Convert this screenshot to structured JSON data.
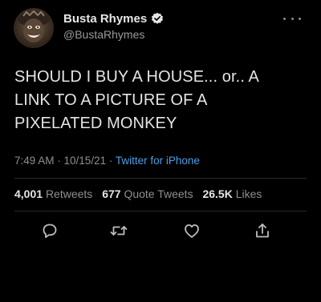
{
  "user": {
    "display_name": "Busta Rhymes",
    "handle": "@BustaRhymes",
    "verified": true
  },
  "tweet": {
    "text_lines": [
      "SHOULD I BUY A HOUSE... or.. A",
      "LINK TO A PICTURE OF A",
      "PIXELATED MONKEY"
    ],
    "time": "7:49 AM",
    "date": "10/15/21",
    "separator": " · ",
    "source": "Twitter for iPhone"
  },
  "stats": {
    "retweets_count": "4,001",
    "retweets_label": "Retweets",
    "quote_count": "677",
    "quote_label": "Quote Tweets",
    "likes_count": "26.5K",
    "likes_label": "Likes"
  },
  "colors": {
    "background": "#000000",
    "link_blue": "#4a9ee8",
    "verified_blue": "#1d9bf0",
    "text_primary": "#e4e4e4",
    "text_secondary": "#8f8f8f"
  },
  "icons": {
    "avatar": "profile-photo",
    "verified": "verified-badge-icon",
    "more": "more-dots-icon",
    "reply": "reply-icon",
    "retweet": "retweet-icon",
    "like": "heart-icon",
    "share": "share-icon"
  }
}
